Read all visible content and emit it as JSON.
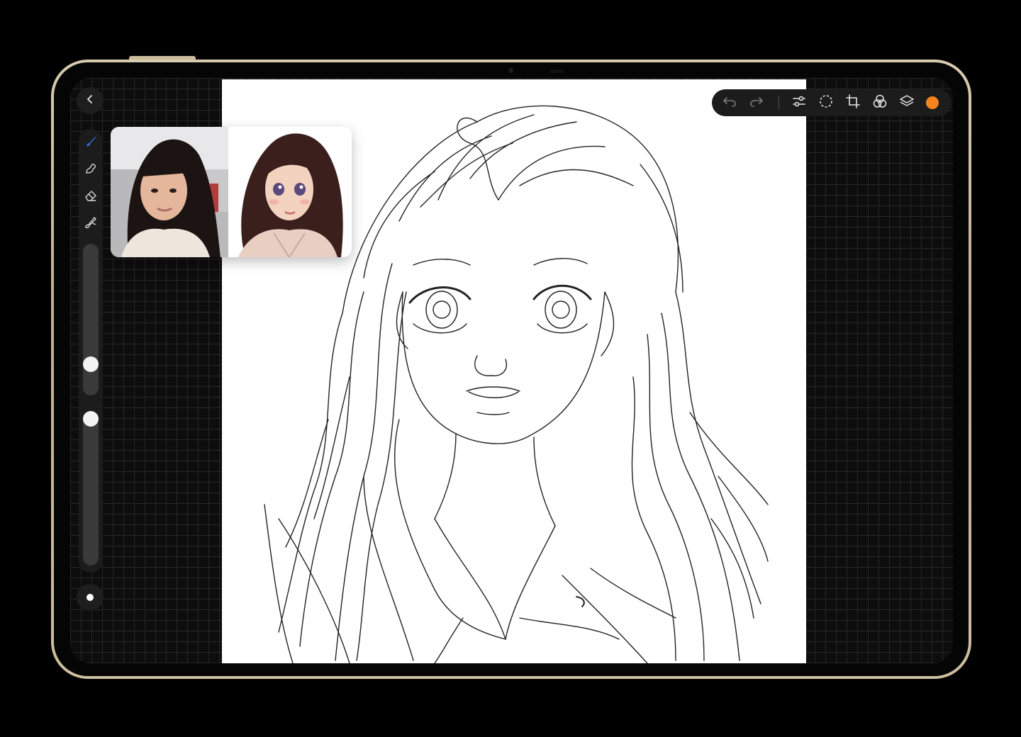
{
  "device": {
    "frame_color": "#cdbf9f"
  },
  "back": {
    "icon": "chevron-left-icon"
  },
  "tools": [
    {
      "name": "brush",
      "icon": "brush-icon",
      "active": true
    },
    {
      "name": "smudge",
      "icon": "smudge-icon",
      "active": false
    },
    {
      "name": "eraser",
      "icon": "eraser-icon",
      "active": false
    },
    {
      "name": "paint",
      "icon": "paint-icon",
      "active": false
    }
  ],
  "sliders": {
    "brush_size": 0.17,
    "opacity": 0.5
  },
  "toolbar": {
    "icons": [
      "undo-icon",
      "redo-icon",
      "adjustments-icon",
      "selection-icon",
      "transform-icon",
      "blend-icon",
      "layers-icon"
    ],
    "current_color": "#f5841f"
  },
  "accent_color": "#2f6bd8",
  "reference": {
    "photo": "reference-photo",
    "cartoon": "cartoon-reference"
  }
}
